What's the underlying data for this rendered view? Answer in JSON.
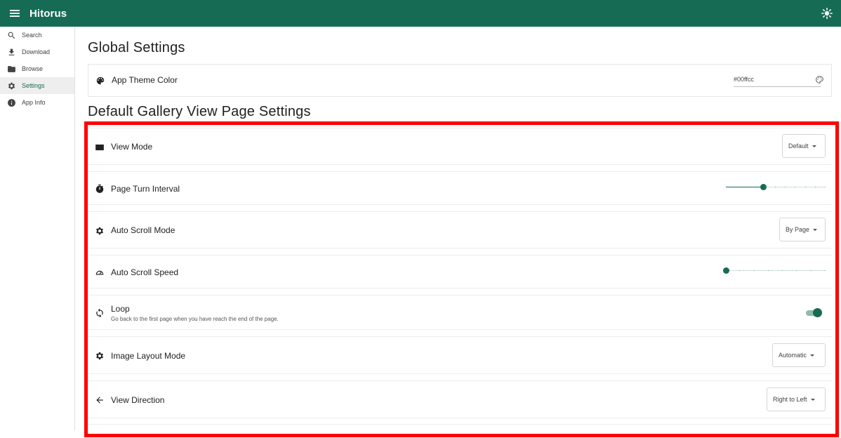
{
  "app": {
    "title": "Hitorus"
  },
  "sidebar": {
    "items": [
      {
        "label": "Search",
        "icon": "search-icon"
      },
      {
        "label": "Download",
        "icon": "download-icon"
      },
      {
        "label": "Browse",
        "icon": "folder-icon"
      },
      {
        "label": "Settings",
        "icon": "gear-icon",
        "active": true
      },
      {
        "label": "App Info",
        "icon": "info-icon"
      }
    ]
  },
  "global": {
    "heading": "Global Settings",
    "theme_color": {
      "label": "App Theme Color",
      "value": "#00ffcc"
    }
  },
  "gallery": {
    "heading": "Default Gallery View Page Settings",
    "view_mode": {
      "label": "View Mode",
      "value": "Default"
    },
    "page_turn_interval": {
      "label": "Page Turn Interval",
      "value_fraction": 0.37,
      "steps": 10
    },
    "auto_scroll_mode": {
      "label": "Auto Scroll Mode",
      "value": "By Page"
    },
    "auto_scroll_speed": {
      "label": "Auto Scroll Speed",
      "value_fraction": 0.0,
      "steps": 7
    },
    "loop": {
      "label": "Loop",
      "description": "Go back to the first page when you have reach the end of the page.",
      "enabled": true
    },
    "image_layout_mode": {
      "label": "Image Layout Mode",
      "value": "Automatic"
    },
    "view_direction": {
      "label": "View Direction",
      "value": "Right to Left"
    }
  },
  "colors": {
    "primary": "#166b55",
    "highlight": "#ff0000"
  }
}
